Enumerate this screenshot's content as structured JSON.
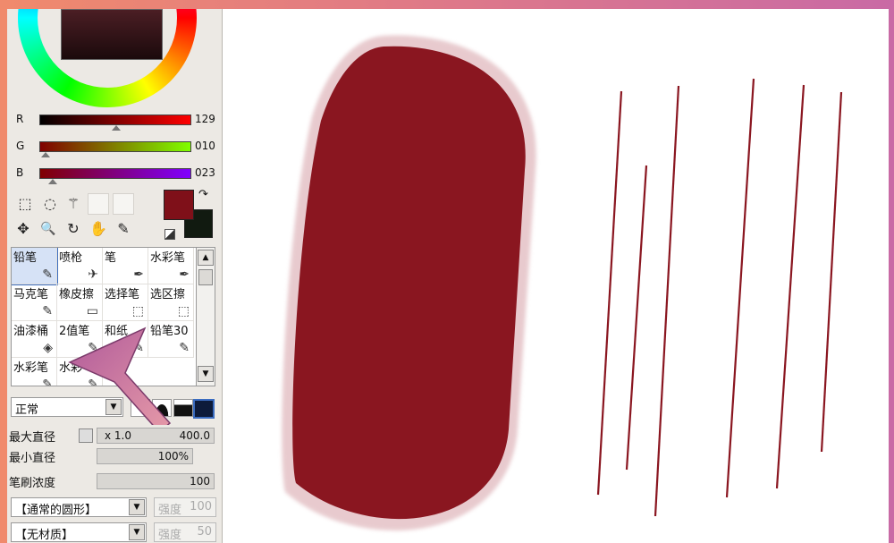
{
  "color": {
    "sliders": [
      {
        "label": "R",
        "value": "129",
        "gradient": "linear-gradient(90deg,#000,#ff0000)",
        "pos": 0.51
      },
      {
        "label": "G",
        "value": "010",
        "gradient": "linear-gradient(90deg,#800000,#80ff00)",
        "pos": 0.04
      },
      {
        "label": "B",
        "value": "023",
        "gradient": "linear-gradient(90deg,#800000,#8000ff)",
        "pos": 0.09
      }
    ],
    "foreground": "#7f1019",
    "background": "#111a10"
  },
  "tools": [
    {
      "name": "rect-select-icon",
      "glyph": "⬚"
    },
    {
      "name": "lasso-icon",
      "glyph": "◌"
    },
    {
      "name": "magic-wand-icon",
      "glyph": "⚚"
    },
    {
      "name": "move-icon",
      "glyph": "✥"
    },
    {
      "name": "zoom-icon",
      "glyph": "🔍"
    },
    {
      "name": "rotate-icon",
      "glyph": "↻"
    },
    {
      "name": "hand-icon",
      "glyph": "✋"
    },
    {
      "name": "eyedropper-icon",
      "glyph": "✎"
    }
  ],
  "brushes": [
    {
      "label": "铅笔",
      "selected": true
    },
    {
      "label": "喷枪"
    },
    {
      "label": "笔"
    },
    {
      "label": "水彩笔"
    },
    {
      "label": "马克笔"
    },
    {
      "label": "橡皮擦"
    },
    {
      "label": "选择笔"
    },
    {
      "label": "选区擦"
    },
    {
      "label": "油漆桶"
    },
    {
      "label": "2值笔"
    },
    {
      "label": "和纸"
    },
    {
      "label": "铅笔30"
    },
    {
      "label": "水彩笔"
    },
    {
      "label": "水彩"
    }
  ],
  "blend_mode": "正常",
  "properties": {
    "max_diameter_label": "最大直径",
    "max_diameter_mult": "x 1.0",
    "max_diameter_value": "400.0",
    "min_diameter_label": "最小直径",
    "min_diameter_value": "100%",
    "density_label": "笔刷浓度",
    "density_value": "100",
    "shape": "【通常的圆形】",
    "shape_strength_label": "强度",
    "shape_strength": "100",
    "texture": "【无材质】",
    "texture_strength_label": "强度",
    "texture_strength": "50"
  },
  "stroke_color": "#8a1620"
}
